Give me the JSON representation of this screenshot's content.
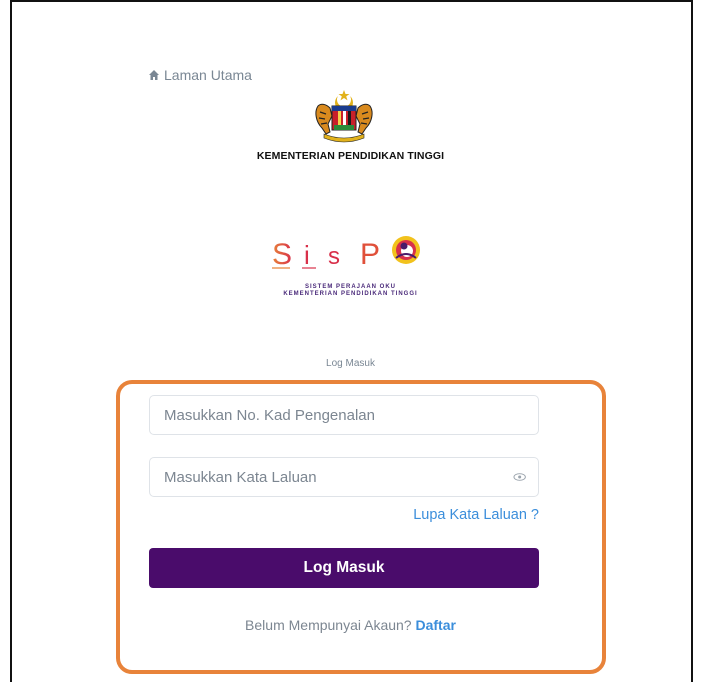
{
  "nav": {
    "home_label": "Laman Utama",
    "home_icon": "home-icon"
  },
  "ministry": {
    "name": "KEMENTERIAN PENDIDIKAN TINGGI",
    "crest_icon": "malaysia-coat-of-arms-icon"
  },
  "brand": {
    "letters": [
      "S",
      "i",
      "s",
      "P"
    ],
    "subtitle_line1": "SISTEM PERAJAAN OKU",
    "subtitle_line2": "KEMENTERIAN PENDIDIKAN TINGGI"
  },
  "login": {
    "title": "Log Masuk",
    "ic_placeholder": "Masukkan No. Kad Pengenalan",
    "password_placeholder": "Masukkan Kata Laluan",
    "forgot_label": "Lupa Kata Laluan ?",
    "submit_label": "Log Masuk",
    "no_account_text": "Belum Mempunyai Akaun?",
    "register_label": "Daftar"
  },
  "colors": {
    "primary_button": "#4a0c6b",
    "link": "#3b8edb",
    "highlight": "#e8833a"
  }
}
